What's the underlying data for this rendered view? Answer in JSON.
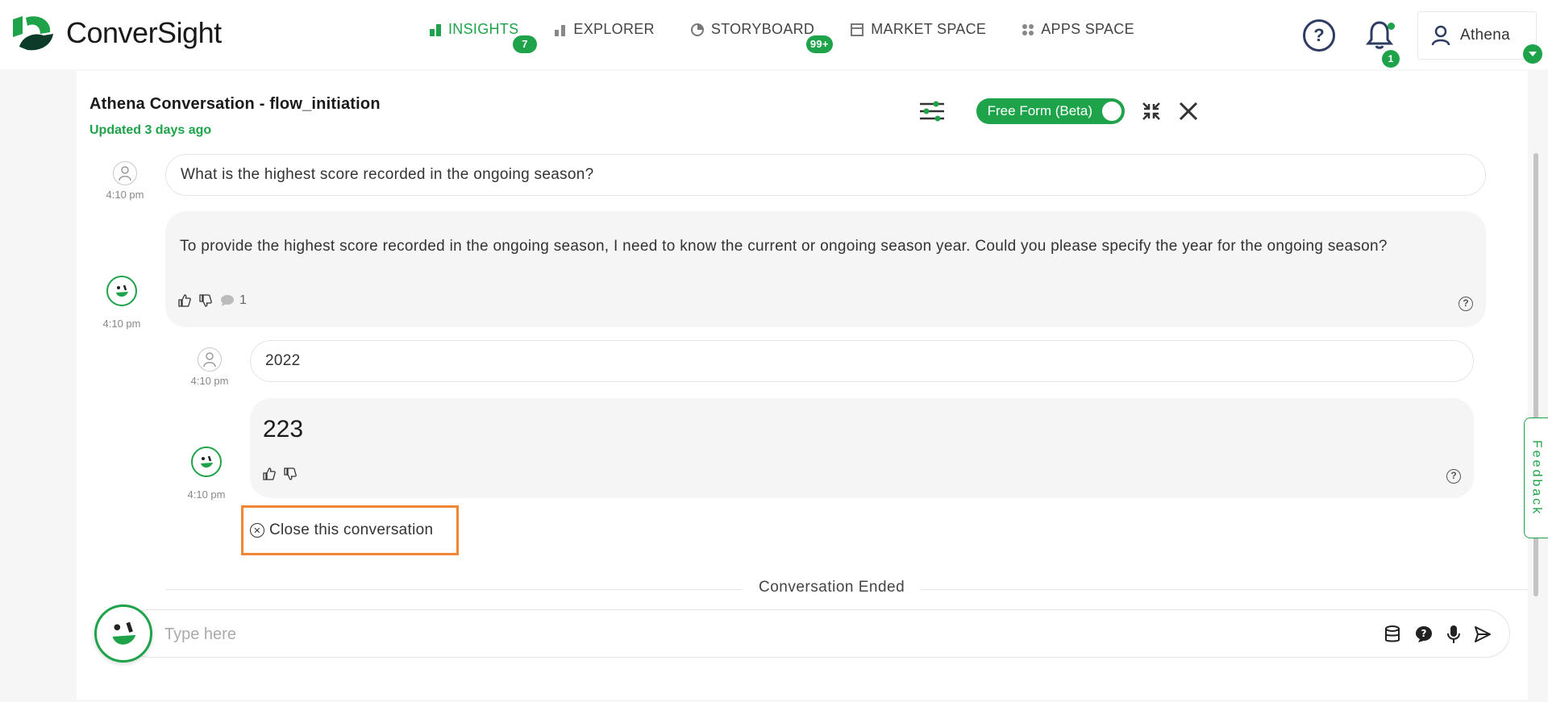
{
  "brand": {
    "name": "ConverSight"
  },
  "nav": {
    "items": [
      {
        "label": "INSIGHTS",
        "badge": "7",
        "active": true,
        "icon": "bar-chart-icon"
      },
      {
        "label": "EXPLORER",
        "badge": "",
        "active": false,
        "icon": "bar-chart-small-icon"
      },
      {
        "label": "STORYBOARD",
        "badge": "99+",
        "active": false,
        "icon": "pie-chart-icon"
      },
      {
        "label": "MARKET SPACE",
        "badge": "",
        "active": false,
        "icon": "store-icon"
      },
      {
        "label": "APPS SPACE",
        "badge": "",
        "active": false,
        "icon": "grid-icon"
      }
    ]
  },
  "topbar": {
    "help": "?",
    "notifications_count": "1",
    "user_name": "Athena"
  },
  "conversation": {
    "title": "Athena Conversation - flow_initiation",
    "updated": "Updated 3 days ago",
    "toggle_label": "Free Form (Beta)",
    "messages": [
      {
        "role": "user",
        "time": "4:10 pm",
        "text": "What is the highest score recorded in the ongoing season?"
      },
      {
        "role": "bot",
        "time": "4:10 pm",
        "text": "To provide the highest score recorded in the ongoing season, I need to know the current or ongoing season year. Could you please specify the year for the ongoing season?",
        "comment_count": "1"
      },
      {
        "role": "user",
        "time": "4:10 pm",
        "text": "2022"
      },
      {
        "role": "bot",
        "time": "4:10 pm",
        "text": "223"
      }
    ],
    "close_label": "Close this conversation",
    "ended_label": "Conversation Ended"
  },
  "input": {
    "placeholder": "Type here"
  },
  "feedback_label": "Feedback",
  "colors": {
    "accent": "#1fa34a",
    "highlight": "#f08533"
  }
}
